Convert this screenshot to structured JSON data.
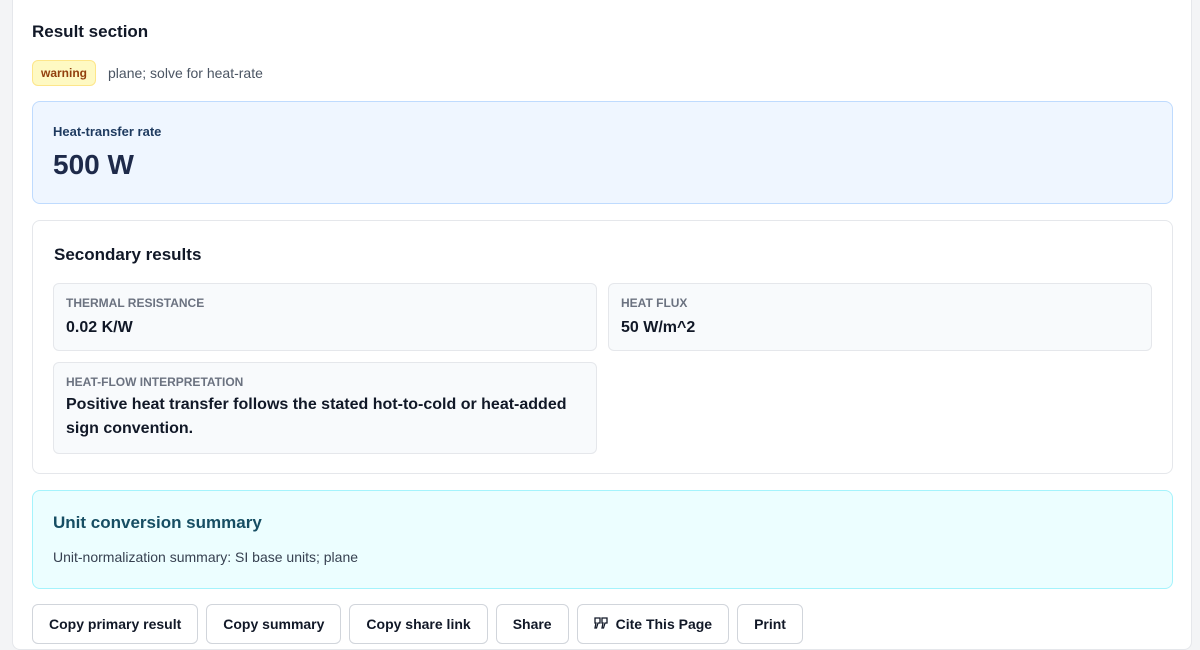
{
  "result": {
    "section_title": "Result section",
    "status_badge": "warning",
    "status_text": "plane; solve for heat-rate"
  },
  "primary": {
    "label": "Heat-transfer rate",
    "value": "500 W"
  },
  "secondary": {
    "title": "Secondary results",
    "metrics": [
      {
        "label": "THERMAL RESISTANCE",
        "value": "0.02 K/W"
      },
      {
        "label": "HEAT FLUX",
        "value": "50 W/m^2"
      },
      {
        "label": "HEAT-FLOW INTERPRETATION",
        "value": "Positive heat transfer follows the stated hot-to-cold or heat-added sign convention."
      }
    ]
  },
  "unit_conversion": {
    "title": "Unit conversion summary",
    "text": "Unit-normalization summary: SI base units; plane"
  },
  "actions": {
    "copy_primary": "Copy primary result",
    "copy_summary": "Copy summary",
    "copy_share_link": "Copy share link",
    "share": "Share",
    "cite": "Cite This Page",
    "print": "Print"
  },
  "colors": {
    "warning_badge_bg": "#fef9c3",
    "primary_card_bg": "#eff6ff",
    "unit_card_bg": "#ecfeff"
  },
  "icons": {
    "cite": "quote-icon"
  }
}
